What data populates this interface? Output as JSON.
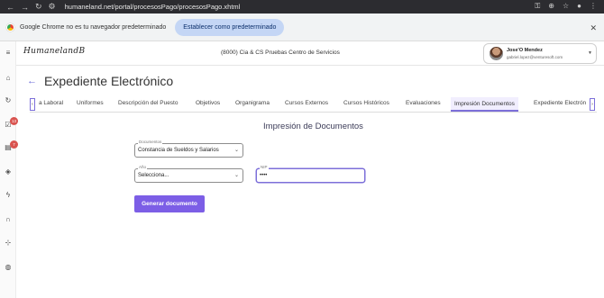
{
  "browser": {
    "url": "humaneland.net/portal/procesosPago/procesosPago.xhtml",
    "infobar_message": "Google Chrome no es tu navegador predeterminado",
    "infobar_button": "Establecer como predeterminado",
    "close_glyph": "✕"
  },
  "sidebar": {
    "badges": [
      "13",
      "7"
    ]
  },
  "header": {
    "logo": "HumanelandB",
    "company": "(8000) Cia & CS Pruebas Centro de Servicios",
    "user_name": "Jose'O Mendez",
    "user_email": "gabriel.lopez@venturesoft.com"
  },
  "page": {
    "back_glyph": "←",
    "title": "Expediente Electrónico"
  },
  "tabs": {
    "left_arrow": "‹",
    "right_arrow": "›",
    "items": [
      "a Laboral",
      "Uniformes",
      "Descripción del Puesto",
      "Objetivos",
      "Organigrama",
      "Cursos Externos",
      "Cursos Históricos",
      "Evaluaciones",
      "Impresión Documentos",
      "Expediente Electrón"
    ],
    "active": "Impresión Documentos"
  },
  "form": {
    "section_title": "Impresión de Documentos",
    "documentos_label": "Documentos",
    "documentos_value": "Constancia de Sueldos y Salarios",
    "ano_label": "Año",
    "ano_value": "Selecciona...",
    "nip_label": "NIP",
    "nip_value": "••••",
    "generate_button": "Generar documento"
  },
  "colors": {
    "accent": "#7c5ee6",
    "badge": "#d9534f",
    "infobar_button_bg": "#c4d6f5"
  }
}
